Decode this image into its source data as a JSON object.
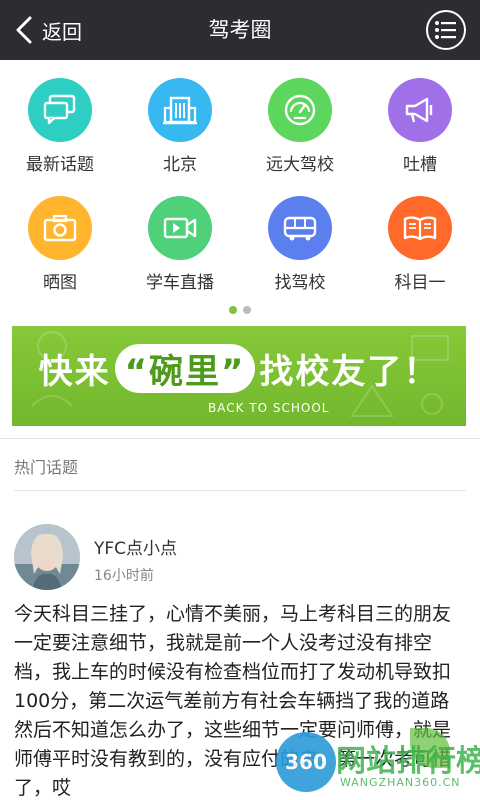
{
  "topbar": {
    "back_label": "返回",
    "title": "驾考圈"
  },
  "grid": [
    {
      "label": "最新话题",
      "icon": "chat-bubbles-icon",
      "color": "#2ecfc2"
    },
    {
      "label": "北京",
      "icon": "building-icon",
      "color": "#37b8f0"
    },
    {
      "label": "远大驾校",
      "icon": "speedometer-icon",
      "color": "#5cd65c"
    },
    {
      "label": "吐槽",
      "icon": "megaphone-icon",
      "color": "#a070e8"
    },
    {
      "label": "晒图",
      "icon": "camera-icon",
      "color": "#ffb52e"
    },
    {
      "label": "学车直播",
      "icon": "video-icon",
      "color": "#4fd17a"
    },
    {
      "label": "找驾校",
      "icon": "bus-icon",
      "color": "#5c7ff0"
    },
    {
      "label": "科目一",
      "icon": "book-icon",
      "color": "#ff6a2a"
    }
  ],
  "pager": {
    "pages": 2,
    "active": 0
  },
  "banner": {
    "prefix": "快来",
    "highlight": "“碗里”",
    "suffix": "找校友了！",
    "sub": "BACK TO SCHOOL"
  },
  "section": {
    "title": "热门话题"
  },
  "post": {
    "username": "YFC点小点",
    "time": "16小时前",
    "content": "今天科目三挂了，心情不美丽，马上考科目三的朋友一定要注意细节，我就是前一个人没考过没有排空档，我上车的时候没有检查档位而打了发动机导致扣100分，第二次运气差前方有社会车辆挡了我的道路然后不知道怎么办了，这些细节一定要问师傅，就是师傅平时没有教到的，没有应付的来，第一次考可惜了，哎"
  },
  "watermark": {
    "logo": "360",
    "title": "网站排行榜",
    "domain": "WANGZHAN360.CN"
  }
}
